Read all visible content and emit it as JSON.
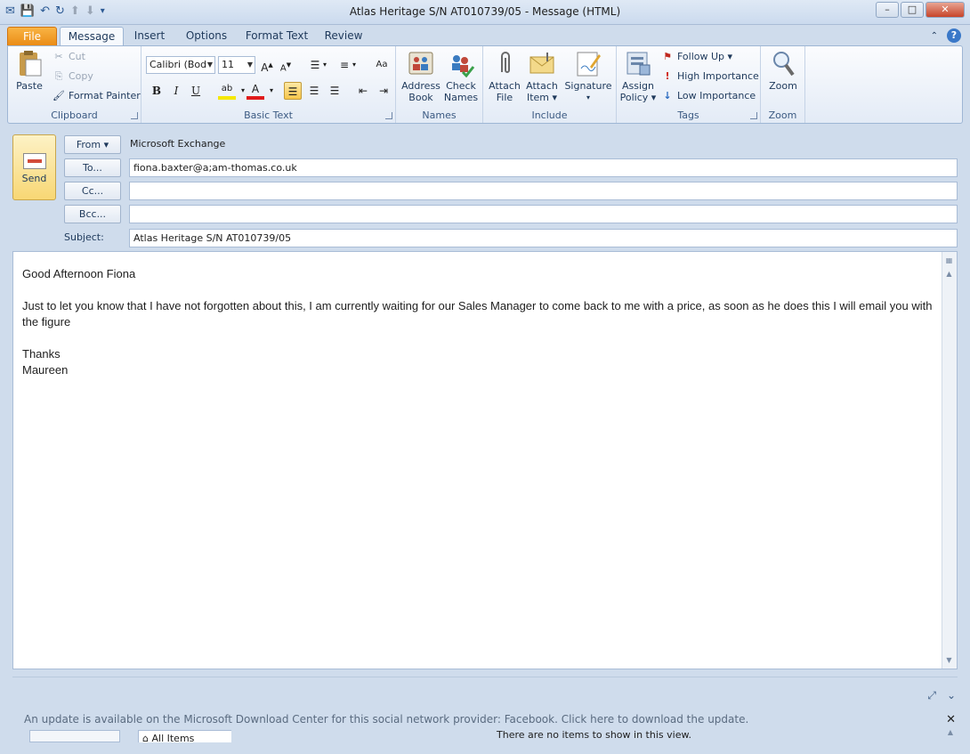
{
  "window": {
    "title": "Atlas Heritage  S/N  AT010739/05  -  Message (HTML)",
    "controls": {
      "minimize": "▭",
      "maximize": "❐",
      "close": "✕"
    }
  },
  "qat": {
    "icons": [
      "outlook-icon",
      "save-icon",
      "undo-icon",
      "redo-icon",
      "up-icon",
      "down-icon",
      "customize-icon"
    ]
  },
  "tabs": [
    "File",
    "Message",
    "Insert",
    "Options",
    "Format Text",
    "Review"
  ],
  "active_tab": "Message",
  "ribbon": {
    "clipboard": {
      "label": "Clipboard",
      "paste": "Paste",
      "cut": "Cut",
      "copy": "Copy",
      "format_painter": "Format Painter"
    },
    "basic_text": {
      "label": "Basic Text",
      "font": "Calibri (Bod",
      "size": "11"
    },
    "names": {
      "label": "Names",
      "address_book": [
        "Address",
        "Book"
      ],
      "check_names": [
        "Check",
        "Names"
      ]
    },
    "include": {
      "label": "Include",
      "attach_file": [
        "Attach",
        "File"
      ],
      "attach_item": [
        "Attach",
        "Item ▾"
      ],
      "signature": "Signature"
    },
    "tags": {
      "label": "Tags",
      "assign_policy": [
        "Assign",
        "Policy ▾"
      ],
      "follow_up": "Follow Up ▾",
      "high_importance": "High Importance",
      "low_importance": "Low Importance"
    },
    "zoom": {
      "label": "Zoom",
      "zoom": "Zoom"
    }
  },
  "compose": {
    "send": "Send",
    "from_button": "From ▾",
    "from_value": "Microsoft Exchange",
    "to_button": "To...",
    "to_value": "fiona.baxter@a;am-thomas.co.uk",
    "cc_button": "Cc...",
    "cc_value": "",
    "bcc_button": "Bcc...",
    "bcc_value": "",
    "subject_label": "Subject:",
    "subject_value": "Atlas Heritage  S/N  AT010739/05"
  },
  "body": {
    "greeting": "Good Afternoon Fiona",
    "paragraph": "Just to let you know that I have not forgotten about this, I am currently waiting for our Sales Manager to come back to me with a price, as soon as he does this I will email you with the figure",
    "closing": "Thanks",
    "signature": "Maureen"
  },
  "people_pane": {
    "update_notice": "An update is available on the Microsoft Download Center for this social network provider: Facebook. Click here to download the update.",
    "all_items": "All Items",
    "no_items": "There are no items to show in this view."
  }
}
